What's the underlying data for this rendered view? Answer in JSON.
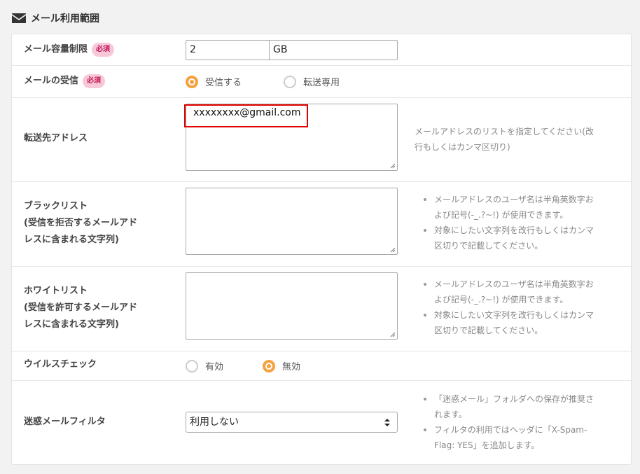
{
  "section": {
    "title": "メール利用範囲"
  },
  "required_badge": "必須",
  "quota": {
    "label": "メール容量制限",
    "value": "2",
    "unit": "GB"
  },
  "receive": {
    "label": "メールの受信",
    "options": [
      {
        "label": "受信する",
        "selected": true
      },
      {
        "label": "転送専用",
        "selected": false
      }
    ]
  },
  "forward": {
    "label": "転送先アドレス",
    "value": "xxxxxxxx@gmail.com",
    "help_line1": "メールアドレスのリストを指定してください(改",
    "help_line2": "行もしくはカンマ区切り)"
  },
  "blacklist": {
    "label_line1": "ブラックリスト",
    "label_line2": "(受信を拒否するメールアド",
    "label_line3": "レスに含まれる文字列)",
    "help": [
      {
        "line1": "メールアドレスのユーザ名は半角英数字お",
        "line2": "よび記号(-_.?~!) が使用できます。"
      },
      {
        "line1": "対象にしたい文字列を改行もしくはカンマ",
        "line2": "区切りで記載してください。"
      }
    ]
  },
  "whitelist": {
    "label_line1": "ホワイトリスト",
    "label_line2": "(受信を許可するメールアド",
    "label_line3": "レスに含まれる文字列)",
    "help": [
      {
        "line1": "メールアドレスのユーザ名は半角英数字お",
        "line2": "よび記号(-_.?~!) が使用できます。"
      },
      {
        "line1": "対象にしたい文字列を改行もしくはカンマ",
        "line2": "区切りで記載してください。"
      }
    ]
  },
  "virus": {
    "label": "ウイルスチェック",
    "options": [
      {
        "label": "有効",
        "selected": false
      },
      {
        "label": "無効",
        "selected": true
      }
    ]
  },
  "spam": {
    "label": "迷惑メールフィルタ",
    "selected": "利用しない",
    "help": [
      {
        "line1": "「迷惑メール」フォルダへの保存が推奨さ",
        "line2": "れます。"
      },
      {
        "line1": "フィルタの利用ではヘッダに「X-Spam-",
        "line2": "Flag: YES」を追加します。"
      }
    ]
  },
  "colors": {
    "accent": "#f5a142",
    "required_bg": "#f7c9d8",
    "highlight": "#e00000"
  },
  "icons": {
    "section": "envelope-icon",
    "select": "updown-arrows-icon"
  }
}
